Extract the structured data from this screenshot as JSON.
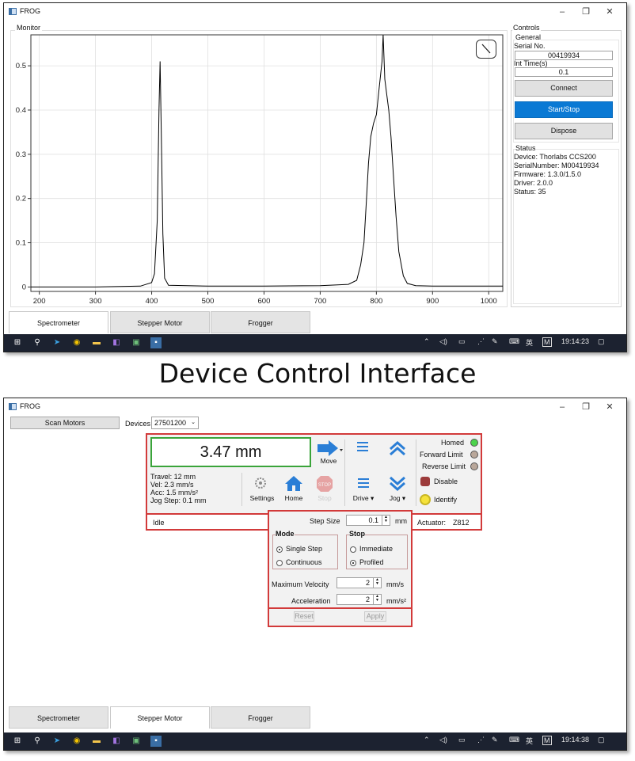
{
  "caption": "Device Control Interface",
  "window1": {
    "title": "FROG",
    "controls": {
      "minimize": "–",
      "maximize": "❐",
      "close": "✕"
    },
    "monitor": {
      "label": "Monitor",
      "zoom_icon": "diagonal-line-icon"
    },
    "panel": {
      "controls_label": "Controls",
      "general_label": "General",
      "serial_label": "Serial No.",
      "serial_value": "00419934",
      "int_time_label": "Int Time(s)",
      "int_time_value": "0.1",
      "connect_label": "Connect",
      "startstop_label": "Start/Stop",
      "dispose_label": "Dispose",
      "status_label": "Status",
      "status_lines": {
        "device": "Device: Thorlabs CCS200",
        "serial": "SerialNumber: M00419934",
        "firmware": "Firmware: 1.3.0/1.5.0",
        "driver": "Driver: 2.0.0",
        "status": "Status: 35"
      }
    },
    "tabs": [
      "Spectrometer",
      "Stepper Motor",
      "Frogger"
    ],
    "active_tab": 0,
    "taskbar": {
      "ime": "英",
      "ime2": "M",
      "time": "19:14:23"
    }
  },
  "window2": {
    "title": "FROG",
    "controls": {
      "minimize": "–",
      "maximize": "❐",
      "close": "✕"
    },
    "scan_motors_label": "Scan Motors",
    "devices_label": "Devices",
    "devices_value": "27501200",
    "position": "3.47 mm",
    "info": {
      "travel": "Travel: 12 mm",
      "vel": "Vel: 2.3 mm/s",
      "acc": "Acc: 1.5 mm/s²",
      "jog_step": "Jog Step: 0.1 mm"
    },
    "buttons": {
      "move": "Move",
      "settings": "Settings",
      "home": "Home",
      "stop": "Stop",
      "drive": "Drive ▾",
      "jog": "Jog ▾",
      "disable": "Disable",
      "identify": "Identify"
    },
    "indicators": {
      "homed": "Homed",
      "forward_limit": "Forward Limit",
      "reverse_limit": "Reverse Limit"
    },
    "status_text": "Idle",
    "actuator_label": "Actuator:",
    "actuator_value": "Z812",
    "jog_panel": {
      "step_size_label": "Step Size",
      "step_size_value": "0.1",
      "step_size_unit": "mm",
      "mode_label": "Mode",
      "mode_single": "Single Step",
      "mode_continuous": "Continuous",
      "stop_label": "Stop",
      "stop_immediate": "Immediate",
      "stop_profiled": "Profiled",
      "max_vel_label": "Maximum Velocity",
      "max_vel_value": "2",
      "max_vel_unit": "mm/s",
      "accel_label": "Acceleration",
      "accel_value": "2",
      "accel_unit": "mm/s²",
      "reset_label": "Reset",
      "apply_label": "Apply"
    },
    "tabs": [
      "Spectrometer",
      "Stepper Motor",
      "Frogger"
    ],
    "active_tab": 1,
    "taskbar": {
      "ime": "英",
      "ime2": "M",
      "time": "19:14:38"
    }
  },
  "chart_data": {
    "type": "line",
    "title": "",
    "xlabel": "",
    "ylabel": "",
    "xlim": [
      185,
      1025
    ],
    "ylim": [
      -0.01,
      0.57
    ],
    "xticks": [
      200,
      300,
      400,
      500,
      600,
      700,
      800,
      900,
      1000
    ],
    "yticks": [
      0,
      0.1,
      0.2,
      0.3,
      0.4,
      0.5
    ],
    "ytick_labels": [
      "0",
      "0.1",
      "0.2",
      "0.3",
      "0.4",
      "0.5"
    ],
    "grid": true,
    "series": [
      {
        "color": "#000000",
        "x": [
          185,
          300,
          380,
          400,
          405,
          410,
          413,
          415,
          417,
          420,
          423,
          430,
          500,
          600,
          700,
          750,
          765,
          772,
          778,
          782,
          786,
          790,
          795,
          800,
          805,
          810,
          812,
          815,
          818,
          822,
          826,
          830,
          835,
          840,
          848,
          855,
          870,
          900,
          1025
        ],
        "y": [
          0.0,
          0.0,
          0.002,
          0.01,
          0.03,
          0.15,
          0.4,
          0.51,
          0.36,
          0.12,
          0.02,
          0.004,
          0.002,
          0.002,
          0.003,
          0.006,
          0.015,
          0.05,
          0.1,
          0.19,
          0.28,
          0.34,
          0.37,
          0.39,
          0.45,
          0.51,
          0.57,
          0.47,
          0.44,
          0.4,
          0.34,
          0.26,
          0.16,
          0.08,
          0.025,
          0.008,
          0.003,
          0.002,
          0.002
        ]
      }
    ]
  }
}
